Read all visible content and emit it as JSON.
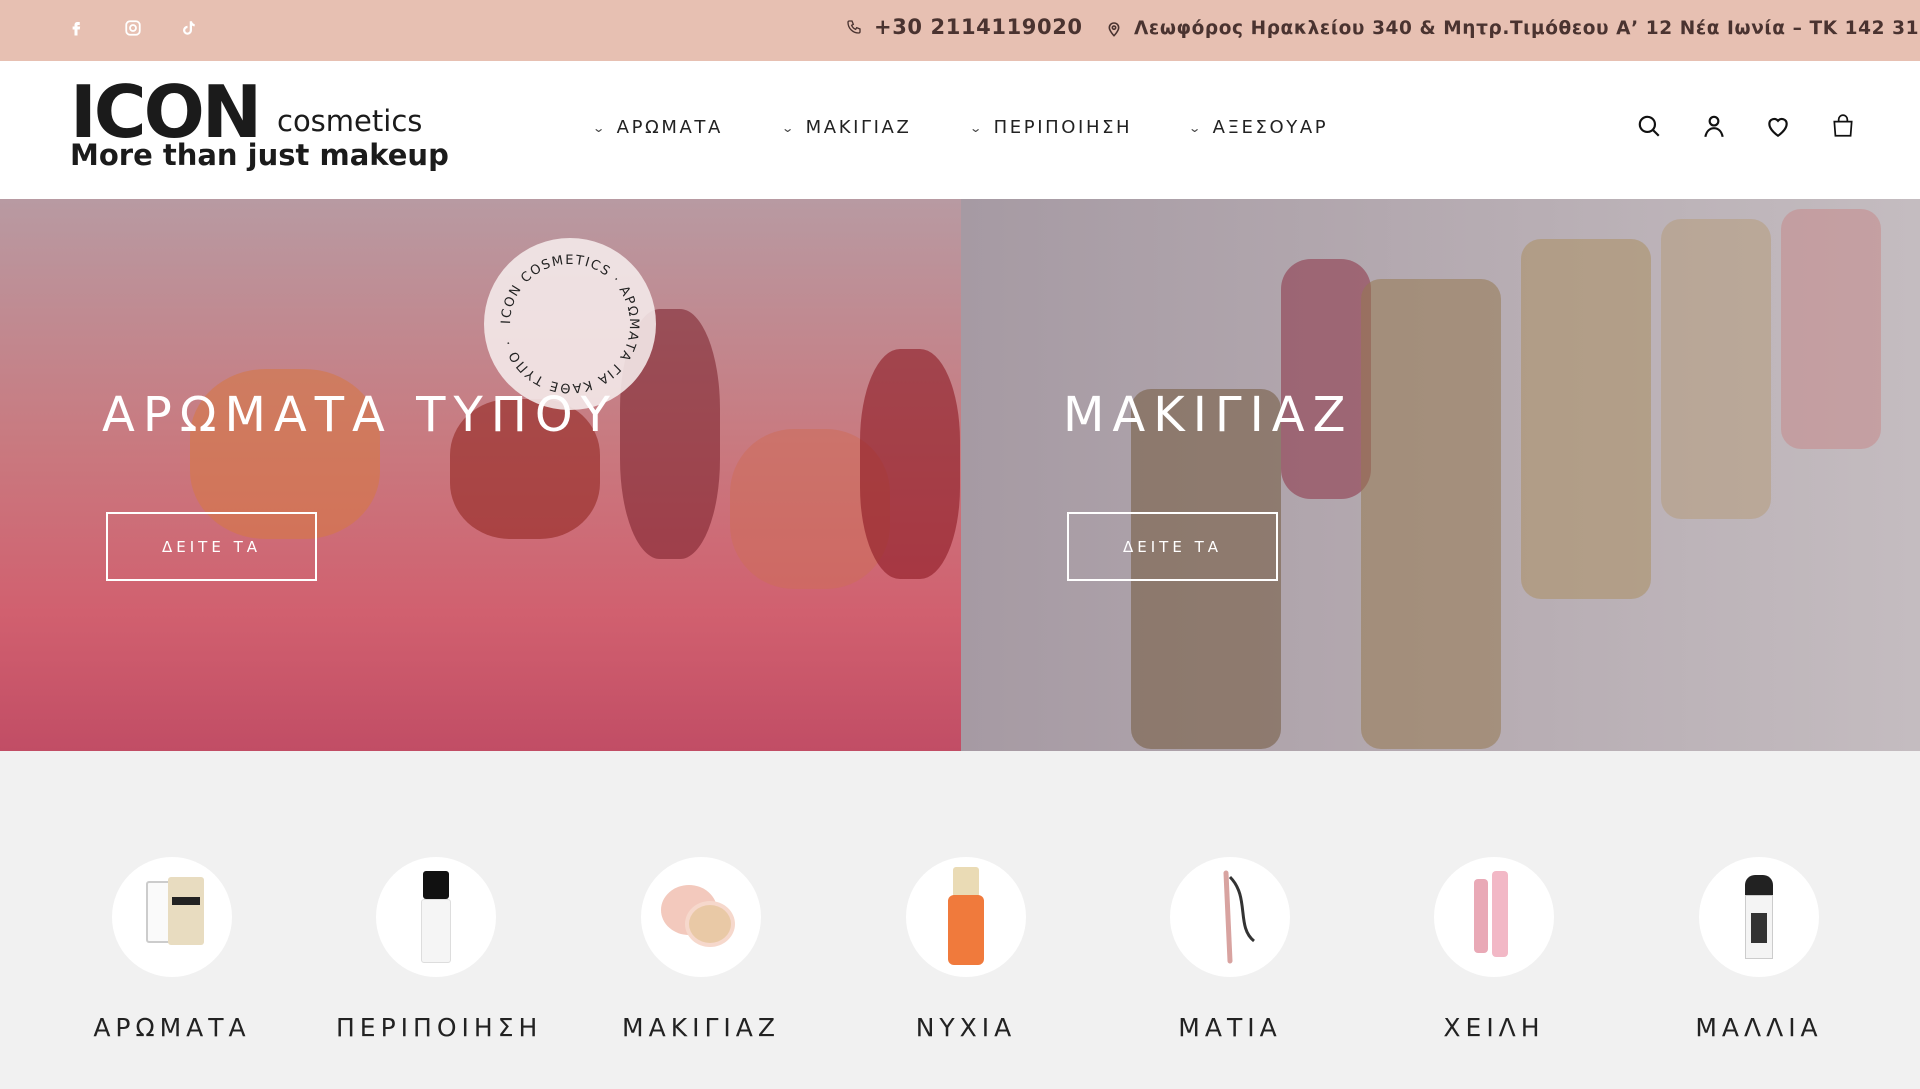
{
  "topbar": {
    "social": [
      {
        "name": "facebook-icon"
      },
      {
        "name": "instagram-icon"
      },
      {
        "name": "tiktok-icon"
      }
    ],
    "phone": "+30 2114119020",
    "address": "Λεωφόρος Ηρακλείου 340 & Μητρ.Τιμόθεου Α’ 12 Νέα Ιωνία – ΤΚ 142 31"
  },
  "header": {
    "logo": {
      "main": "ICON",
      "sub": "cosmetics",
      "tagline": "More than just makeup"
    },
    "nav": [
      "ΑΡΩΜΑΤΑ",
      "ΜΑΚΙΓΙΑΖ",
      "ΠΕΡΙΠΟΙΗΣΗ",
      "ΑΞΕΣΟΥΑΡ"
    ],
    "icons": [
      "search-icon",
      "account-icon",
      "wishlist-icon",
      "cart-icon"
    ]
  },
  "hero": {
    "left": {
      "title": "ΑΡΩΜΑΤΑ ΤΥΠΟΥ",
      "button": "ΔΕΙΤΕ ΤΑ",
      "badge_text": "ICON COSMETICS · ΑΡΩΜΑΤΑ ΓΙΑ ΚΑΘΕ ΤΥΠΟ ·"
    },
    "right": {
      "title": "ΜΑΚΙΓΙΑΖ",
      "button": "ΔΕΙΤΕ ΤΑ"
    }
  },
  "categories": [
    "ΑΡΩΜΑΤΑ",
    "ΠΕΡΙΠΟΙΗΣΗ",
    "ΜΑΚΙΓΙΑΖ",
    "ΝΥΧΙΑ",
    "ΜΑΤΙΑ",
    "ΧΕΙΛΗ",
    "ΜΑΛΛΙΑ"
  ],
  "colors": {
    "topbar": "#e7c0b2",
    "categories_bg": "#f1f1f1",
    "text": "#222222"
  }
}
